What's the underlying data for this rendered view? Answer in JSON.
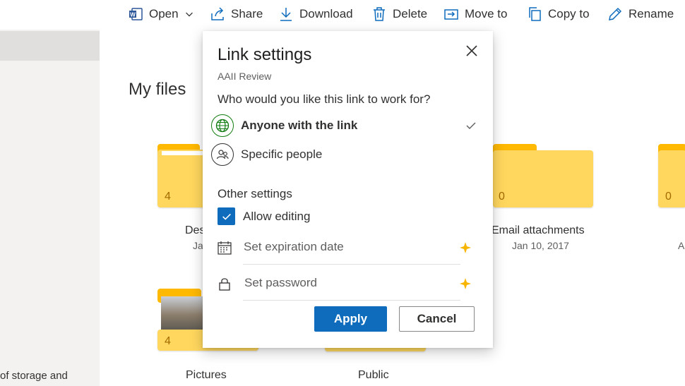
{
  "toolbar": {
    "open": "Open",
    "share": "Share",
    "download": "Download",
    "delete": "Delete",
    "move_to": "Move to",
    "copy_to": "Copy to",
    "rename": "Rename"
  },
  "sidebar": {
    "storage_text": "of storage and"
  },
  "main": {
    "title": "My files",
    "folders": [
      {
        "name": "Des",
        "date": "Ja",
        "count": "4"
      },
      {
        "name": "Email attachments",
        "date": "Jan 10, 2017",
        "count": "0"
      },
      {
        "name": "",
        "date": "A",
        "count": "0"
      },
      {
        "name": "Pictures",
        "date": "",
        "count": "4"
      },
      {
        "name": "Public",
        "date": "",
        "count": ""
      }
    ]
  },
  "dialog": {
    "title": "Link settings",
    "subtitle": "AAII Review",
    "question": "Who would you like this link to work for?",
    "options": [
      {
        "label": "Anyone with the link",
        "selected": true
      },
      {
        "label": "Specific people",
        "selected": false
      }
    ],
    "other_settings_title": "Other settings",
    "allow_editing_label": "Allow editing",
    "allow_editing_checked": true,
    "expiration_placeholder": "Set expiration date",
    "password_placeholder": "Set password",
    "apply_label": "Apply",
    "cancel_label": "Cancel"
  },
  "colors": {
    "accent": "#0f6cbd",
    "folder_back": "#ffb900",
    "folder_front": "#ffd75e",
    "premium_star": "#f7b500",
    "globe_green": "#107c10"
  }
}
